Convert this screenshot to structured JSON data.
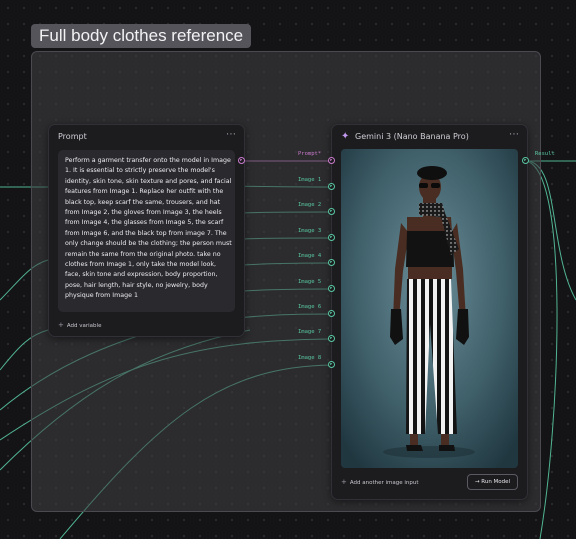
{
  "group": {
    "title": "Full body clothes reference"
  },
  "prompt_node": {
    "title": "Prompt",
    "menu_icon": "more-horizontal-icon",
    "text": "Perform a garment transfer onto the model in Image 1. It is essential to strictly preserve the model's identity, skin tone, skin texture and pores, and facial features from Image 1. Replace her outfit with the black top, keep scarf the same, trousers, and hat from Image 2, the gloves from Image 3, the heels from Image 4, the glasses from Image 5, the scarf from Image 6, and the black top from image 7. The only change should be the clothing; the person must remain the same from the original photo. take no clothes from Image 1, only take the model look, face, skin tone and expression, body proportion, pose, hair length, hair style, no jewelry, body physique from Image 1",
    "add_variable_label": "Add variable"
  },
  "gemini_node": {
    "title": "Gemini 3 (Nano Banana Pro)",
    "icon": "sparkle-icon",
    "menu_icon": "more-horizontal-icon",
    "add_image_label": "Add another image input",
    "run_label": "Run Model",
    "run_icon": "arrow-right-icon",
    "inputs": [
      {
        "label": "Prompt*",
        "color": "#c97acb"
      },
      {
        "label": "Image 1",
        "color": "#58c6a0"
      },
      {
        "label": "Image 2",
        "color": "#58c6a0"
      },
      {
        "label": "Image 3",
        "color": "#58c6a0"
      },
      {
        "label": "Image 4",
        "color": "#58c6a0"
      },
      {
        "label": "Image 5",
        "color": "#58c6a0"
      },
      {
        "label": "Image 6",
        "color": "#58c6a0"
      },
      {
        "label": "Image 7",
        "color": "#58c6a0"
      },
      {
        "label": "Image 8",
        "color": "#58c6a0"
      }
    ],
    "output_label": "Result"
  },
  "colors": {
    "text_wire": "#c97acb",
    "image_wire": "#58c6a0",
    "canvas": "#141416"
  }
}
